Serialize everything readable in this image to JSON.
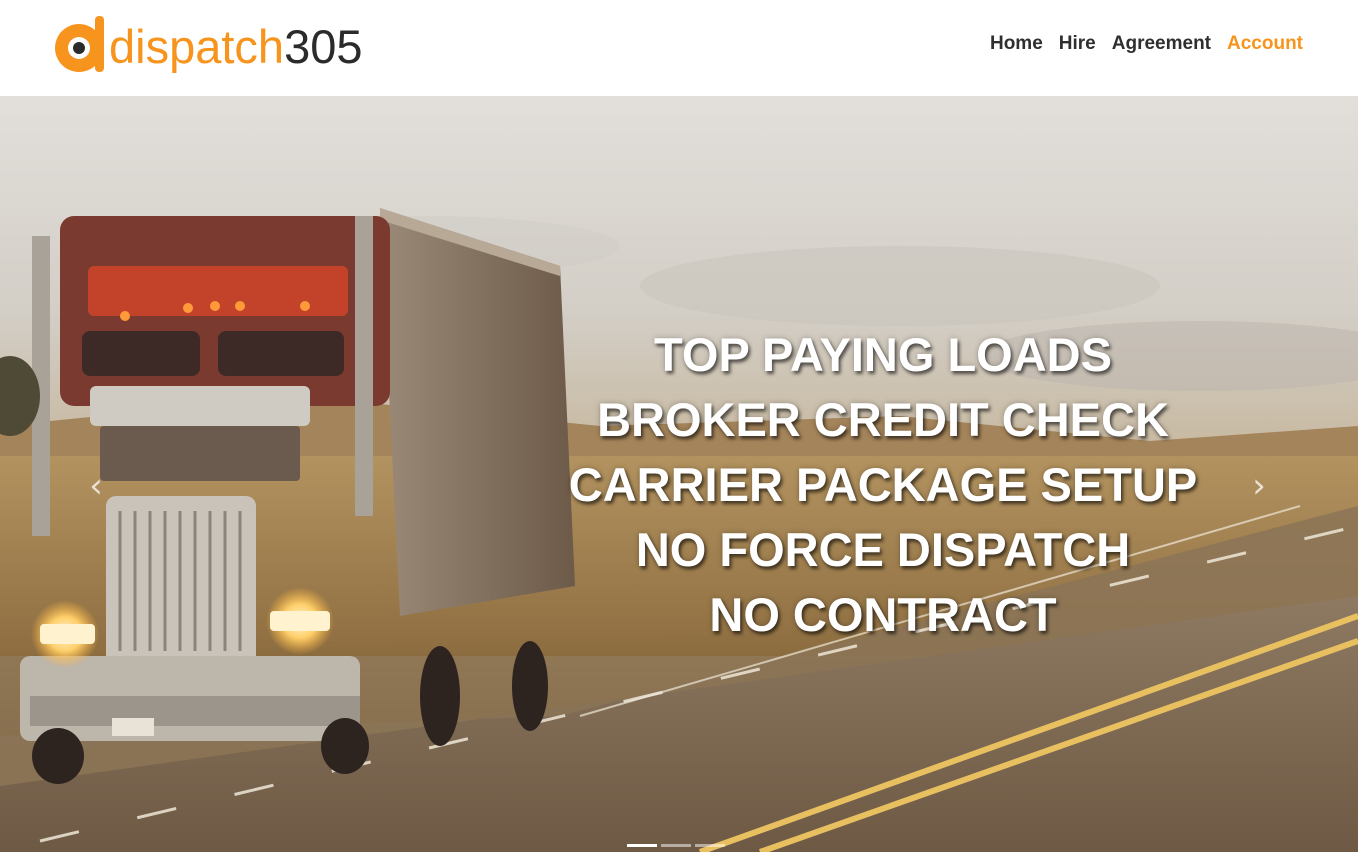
{
  "brand": {
    "name_main": "dispatch",
    "name_num": "305",
    "accent_color": "#f7941d",
    "dark_color": "#2b2b2b"
  },
  "nav": {
    "items": [
      {
        "label": "Home",
        "active": false
      },
      {
        "label": "Hire",
        "active": false
      },
      {
        "label": "Agreement",
        "active": false
      },
      {
        "label": "Account",
        "active": true
      }
    ]
  },
  "hero": {
    "lines": [
      "TOP PAYING LOADS",
      "BROKER CREDIT CHECK",
      "CARRIER PACKAGE SETUP",
      "NO FORCE DISPATCH",
      "NO CONTRACT"
    ],
    "prev_icon": "chevron-left-icon",
    "next_icon": "chevron-right-icon",
    "slide_count": 3,
    "active_slide": 1
  }
}
